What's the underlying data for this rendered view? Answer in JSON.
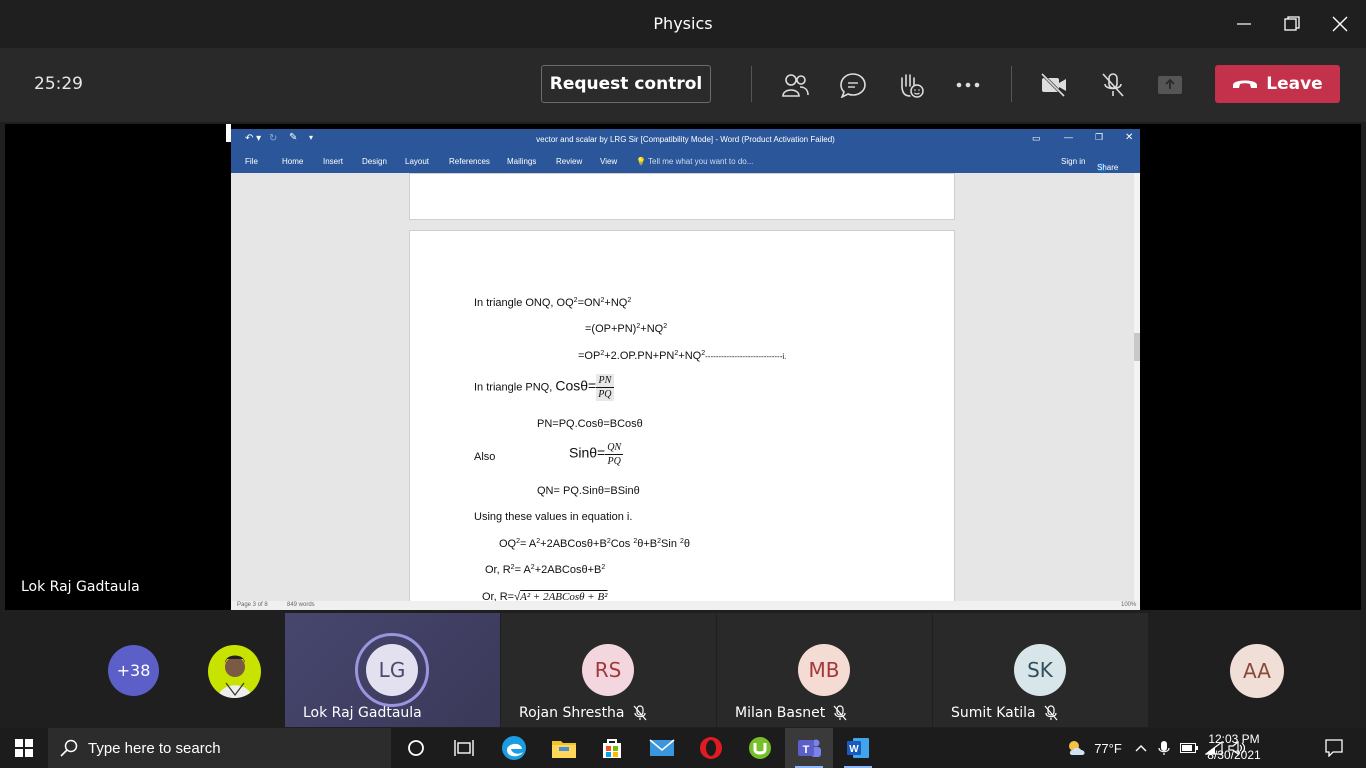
{
  "window": {
    "title": "Physics"
  },
  "toolbar": {
    "timer": "25:29",
    "request_control": "Request control",
    "leave": "Leave"
  },
  "stage": {
    "presenter_name": "Lok Raj Gadtaula"
  },
  "word": {
    "title": "vector and scalar by LRG Sir [Compatibility Mode] - Word (Product Activation Failed)",
    "menu": [
      "File",
      "Home",
      "Insert",
      "Design",
      "Layout",
      "References",
      "Mailings",
      "Review",
      "View"
    ],
    "tell_me": "Tell me what you want to do...",
    "sign_in": "Sign in",
    "share": "Share",
    "status_page": "Page 3 of 8",
    "status_words": "849 words",
    "zoom": "100%",
    "doc": {
      "l1": "In triangle ONQ,  OQ",
      "l1b": "=ON",
      "l1c": "+NQ",
      "l2": "=(OP+PN)",
      "l2b": "+NQ",
      "l3": "=OP",
      "l3b": "+2.OP.PN+PN",
      "l3c": "+NQ",
      "l3d": "-----------------------------i.",
      "l4": "In triangle PNQ, ",
      "l4cos": "Cosθ=",
      "l4num": "PN",
      "l4den": "PQ",
      "l5": "PN=PQ.Cosθ=BCosθ",
      "l6": "Also",
      "l6sin": "Sinθ=",
      "l6num": "QN",
      "l6den": "PQ",
      "l7": "QN= PQ.Sinθ=BSinθ",
      "l8": "Using these values in equation i.",
      "l9": "OQ",
      "l9b": "= A",
      "l9c": "+2ABCosθ+B",
      "l9d": "Cos ",
      "l9e": "θ+B",
      "l9f": "Sin ",
      "l9g": "θ",
      "l10": "Or, R",
      "l10b": "= A",
      "l10c": "+2ABCosθ+B",
      "l11": "Or, R=√",
      "l11b": "A² + 2ABCosθ + B²",
      "sq": "2"
    }
  },
  "participants": [
    {
      "label": "+38",
      "color": "#5b5fc7"
    },
    {
      "label": "",
      "color": "#c9e300"
    },
    {
      "label": "LG",
      "name": "Lok Raj Gadtaula",
      "color": "#e3e0ef"
    },
    {
      "label": "RS",
      "name": "Rojan Shrestha",
      "color": "#f3d6de"
    },
    {
      "label": "MB",
      "name": "Milan Basnet",
      "color": "#f4dbd3"
    },
    {
      "label": "SK",
      "name": "Sumit Katila",
      "color": "#d8e6ea"
    },
    {
      "label": "AA",
      "color": "#f0dfd7"
    }
  ],
  "taskbar": {
    "search_placeholder": "Type here to search",
    "weather": "77°F",
    "time": "12:03 PM",
    "date": "8/30/2021"
  },
  "colors": {
    "leave": "#c4314b",
    "word_blue": "#2b579a",
    "teams_purple": "#5b5fc7"
  }
}
